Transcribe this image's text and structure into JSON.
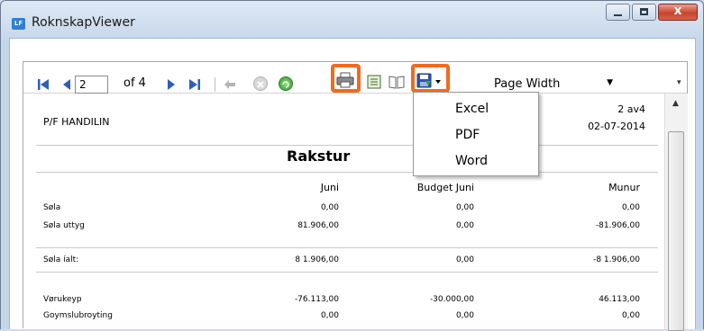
{
  "window": {
    "app_icon_text": "LF",
    "title": "RoknskapViewer",
    "close_glyph": "x"
  },
  "toolbar": {
    "current_page": "2",
    "of_label": "of 4",
    "zoom_value": "Page Width"
  },
  "export_menu": {
    "items": [
      "Excel",
      "PDF",
      "Word"
    ]
  },
  "report": {
    "company": "P/F HANDILIN",
    "page_indicator": "2 av4",
    "date_label_partial": ":",
    "date": "02-07-2014",
    "title": "Rakstur",
    "columns": [
      "Juni",
      "Budget Juni",
      "Munur"
    ],
    "rows": [
      {
        "label": "Søla",
        "c1": "0,00",
        "c2": "0,00",
        "c3": "0,00"
      },
      {
        "label": "Søla uttyg",
        "c1": "81.906,00",
        "c2": "0,00",
        "c3": "-81.906,00"
      },
      {
        "label": "Søla íalt:",
        "c1": "8 1.906,00",
        "c2": "0,00",
        "c3": "-8 1.906,00"
      },
      {
        "label": "Vørukeyp",
        "c1": "-76.113,00",
        "c2": "-30.000,00",
        "c3": "46.113,00"
      },
      {
        "label": "Goymslubroyting",
        "c1": "0,00",
        "c2": "0,00",
        "c3": "0,00"
      }
    ]
  },
  "colors": {
    "highlight": "#f26a1c",
    "nav_blue": "#2d5fb8"
  }
}
